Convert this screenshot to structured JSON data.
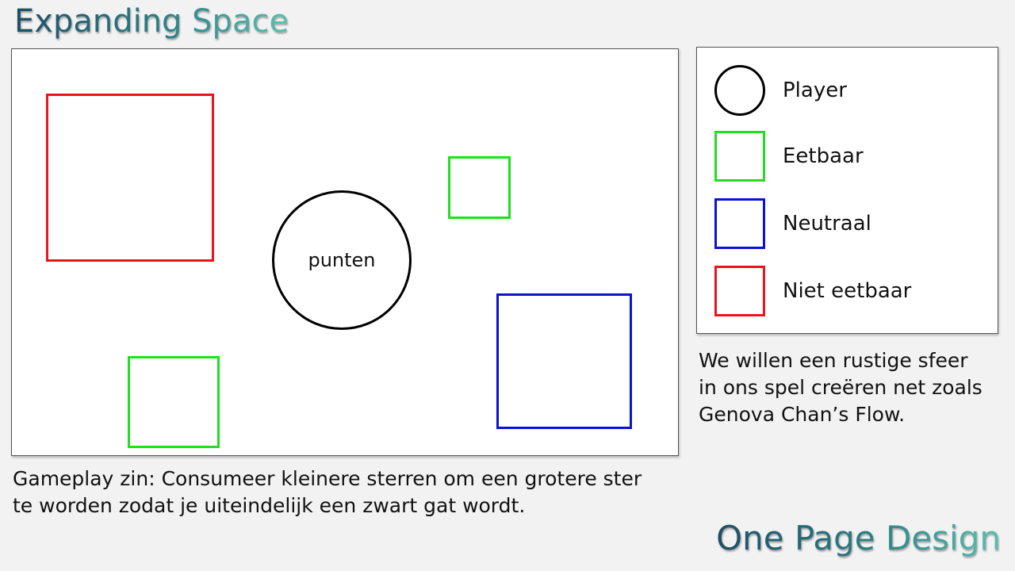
{
  "slide": {
    "title": "Expanding Space",
    "footer_title": "One Page Design"
  },
  "board": {
    "player_label": "punten",
    "pieces": [
      {
        "kind": "niet-eetbaar",
        "color": "#e8141e"
      },
      {
        "kind": "eetbaar",
        "color": "#22dd22"
      },
      {
        "kind": "eetbaar",
        "color": "#22dd22"
      },
      {
        "kind": "neutraal",
        "color": "#0a14d0"
      }
    ]
  },
  "legend": {
    "items": [
      {
        "label": "Player",
        "shape": "circle",
        "color": "#000000"
      },
      {
        "label": "Eetbaar",
        "shape": "square",
        "color": "#22dd22"
      },
      {
        "label": "Neutraal",
        "shape": "square",
        "color": "#0a14d0"
      },
      {
        "label": "Niet eetbaar",
        "shape": "square",
        "color": "#e8141e"
      }
    ]
  },
  "captions": {
    "gameplay_line1": "Gameplay zin: Consumeer kleinere sterren om een grotere ster",
    "gameplay_line2": "te worden zodat je uiteindelijk een zwart gat wordt.",
    "note_line1": "We willen een rustige sfeer",
    "note_line2": "in ons spel creëren net zoals",
    "note_line3": "Genova Chan’s Flow."
  }
}
